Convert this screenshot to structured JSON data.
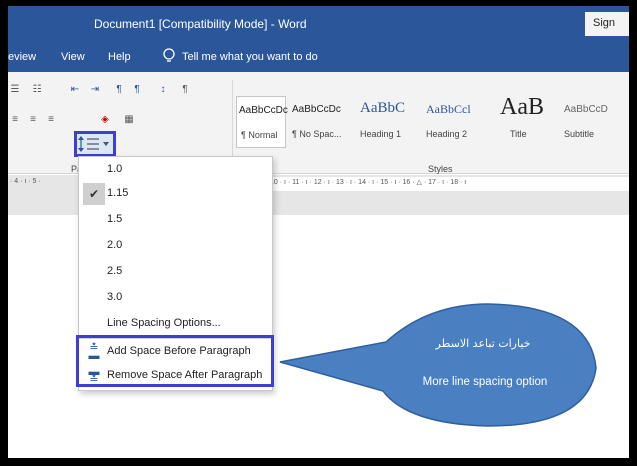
{
  "window": {
    "title": "Document1 [Compatibility Mode] - Word",
    "signin_label": "Sign"
  },
  "menu": {
    "items": [
      "eview",
      "View",
      "Help"
    ],
    "tell_me": "Tell me what you want to do"
  },
  "styles": [
    {
      "preview": "AaBbCcDc",
      "label": "¶ Normal",
      "selected": true
    },
    {
      "preview": "AaBbCcDc",
      "label": "¶ No Spac...",
      "selected": false
    },
    {
      "preview": "AaBbC",
      "label": "Heading 1",
      "selected": false
    },
    {
      "preview": "AaBbCcl",
      "label": "Heading 2",
      "selected": false
    },
    {
      "preview": "AaB",
      "label": "Title",
      "selected": false
    },
    {
      "preview": "AaBbCcD",
      "label": "Subtitle",
      "selected": false
    }
  ],
  "ribbon": {
    "styles_group_label": "Styles",
    "paragraph_group_label": "Pa"
  },
  "ruler": {
    "left_marks": "· 4 · ı · 5 ·",
    "right_marks": "10 · ı · 11 · ı · 12 · ı · 13 · ı · 14 · ı · 15 · ı · 16 · △ · 17 · ı · 18 · ı"
  },
  "line_spacing_menu": {
    "options": [
      "1.0",
      "1.15",
      "1.5",
      "2.0",
      "2.5",
      "3.0"
    ],
    "selected": "1.15",
    "options_label": "Line Spacing Options...",
    "add_before": "Add Space Before Paragraph",
    "remove_after": "Remove Space After Paragraph"
  },
  "callout": {
    "arabic": "خيارات تباعد الاسطر",
    "english": "More line spacing option",
    "fill_color": "#4a7fc1"
  },
  "colors": {
    "titlebar": "#2b579a",
    "highlight": "#3e3fd0"
  }
}
